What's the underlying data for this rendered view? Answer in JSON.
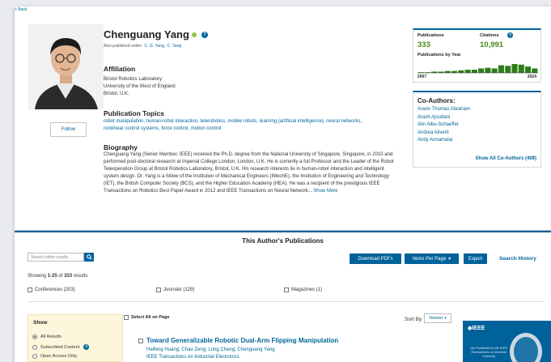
{
  "nav": {
    "back": "< Back"
  },
  "profile": {
    "name": "Chenguang Yang",
    "also_published_prefix": "Also published under:",
    "aliases": [
      "C. G. Yang,",
      "C. Yang"
    ],
    "follow": "Follow",
    "affiliation_title": "Affiliation",
    "affiliation": [
      "Bristol Robotics Laboratory",
      "University of the West of England",
      "Bristol, U.K."
    ],
    "topics_title": "Publication Topics",
    "topics": "robot manipulation, human-robot interaction, telerobotics, mobile robots, learning (artificial intelligence), neural networks, nonlinear control systems, force control, motion control",
    "biography_title": "Biography",
    "biography": "Chenguang Yang (Senior Member, IEEE) received the Ph.D. degree from the National University of Singapore, Singapore, in 2010 and performed post-doctoral research at Imperial College London, London, U.K. He is currently a full Professor and the Leader of the Robot Teleoperation Group at Bristol Robotics Laboratory, Bristol, U.K. His research interests lie in human-robot interaction and intelligent system design. Dr. Yang is a follow of the Institution of Mechanical Engineers (IMechE), the Institution of Engineering and Technology (IET), the British Computer Society (BCS), and the Higher Education Academy (HEA). He was a recipient of the prestigious IEEE Transactions on Robotics Best Paper Award in 2012 and IEEE Transactions on Neural Network...",
    "show_more": "Show More"
  },
  "stats": {
    "publications_label": "Publications",
    "publications_value": "333",
    "citations_label": "Citations",
    "citations_value": "10,991",
    "by_year_label": "Publications by Year",
    "year_start": "2007",
    "year_end": "2024",
    "accent": "#4a8a1a"
  },
  "chart_data": {
    "type": "bar",
    "title": "Publications by Year",
    "x": [
      "2007",
      "2024"
    ],
    "values": [
      1,
      1,
      2,
      2,
      3,
      3,
      4,
      5,
      5,
      7,
      8,
      7,
      12,
      11,
      14,
      13,
      10,
      7
    ],
    "bar_color": "#2e7d1a",
    "line_color": "#222222"
  },
  "coauthors": {
    "title": "Co-Authors:",
    "list": [
      "Aswin Thomas Abraham",
      "Arash Ajoudani",
      "Alin Albu-Schaeffer",
      "Andrea Aliverti",
      "Andy Annamalai"
    ],
    "show_all": "Show All Co-Authors (409)"
  },
  "publications": {
    "header": "This Author's Publications",
    "search_placeholder": "Search within results",
    "download": "Download PDFs",
    "items_per_page": "Items Per Page",
    "export": "Export",
    "search_history": "Search History",
    "showing_prefix": "Showing",
    "showing_range": "1-25",
    "showing_of": "of",
    "showing_total": "333",
    "showing_suffix": "results",
    "filters": [
      "Conferences (203)",
      "Journals (129)",
      "Magazines (1)"
    ],
    "show_title": "Show",
    "show_options": [
      "All Results",
      "Subscribed Content",
      "Open Access Only"
    ],
    "select_all": "Select All on Page",
    "sort_by": "Sort By",
    "sort_value": "Newest",
    "result": {
      "title": "Toward Generalizable Robotic Dual-Arm Flipping Manipulation",
      "authors": "Haifeng Huang; Chao Zeng; Long Cheng; Chenguang Yang",
      "journal": "IEEE Transactions on Industrial Electronics"
    },
    "ad": {
      "logo": "IEEE",
      "text": "Get Published in the IEEE Transactions on Machine Learning"
    }
  }
}
